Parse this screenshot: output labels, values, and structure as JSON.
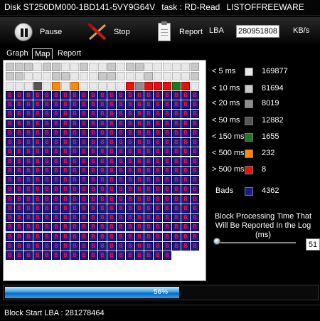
{
  "window": {
    "title_disk": "Disk ST250DM000-1BD141-5VY9G64V",
    "title_task": "task : RD-Read",
    "title_brand": "LISTOFFREEWARE"
  },
  "toolbar": {
    "pause_label": "Pause",
    "stop_label": "Stop",
    "report_label": "Report",
    "lba_label": "LBA",
    "lba_value": "280951808",
    "speed_unit": "KB/s"
  },
  "tabs": [
    {
      "label": "Graph",
      "active": false
    },
    {
      "label": "Map",
      "active": true
    },
    {
      "label": "Report",
      "active": false
    }
  ],
  "map": {
    "bad_glyph": "B",
    "cells_before_bad": [
      "g1",
      "g1",
      "g1",
      "g0",
      "g1",
      "g1",
      "g0",
      "g0",
      "g1",
      "g0",
      "g0",
      "g1",
      "g0",
      "g1",
      "g1",
      "g0",
      "g0",
      "g0",
      "g0",
      "g0",
      "g1",
      "g1",
      "g1",
      "g0",
      "g0",
      "g0",
      "g1",
      "g1",
      "g0",
      "g0",
      "g0",
      "g1",
      "g1",
      "g0",
      "g0",
      "g0",
      "g1",
      "g0",
      "g0",
      "g0",
      "g0",
      "g1",
      "g0",
      "g0",
      "g0",
      "g3",
      "g0",
      "or",
      "g0",
      "or",
      "g0",
      "g0",
      "g0",
      "g0",
      "g0",
      "rd",
      "g2",
      "rd",
      "rd",
      "rd",
      "gr",
      "rd",
      "g0"
    ],
    "bad_rows": 18,
    "columns": 21,
    "last_row_bad_count": 18
  },
  "legend": [
    {
      "label": "< 5 ms",
      "count": "169877",
      "color": "#e8e8e8"
    },
    {
      "label": "< 10 ms",
      "count": "81694",
      "color": "#c8c8c8"
    },
    {
      "label": "< 20 ms",
      "count": "8019",
      "color": "#8e8e8e"
    },
    {
      "label": "< 50 ms",
      "count": "12882",
      "color": "#555555"
    },
    {
      "label": "< 150 ms",
      "count": "1655",
      "color": "#1f7a1f"
    },
    {
      "label": "< 500 ms",
      "count": "232",
      "color": "#ff8a00"
    },
    {
      "label": "> 500 ms",
      "count": "8",
      "color": "#e81010"
    },
    {
      "label": "Bads",
      "count": "4362",
      "color": "#1a1a8c"
    }
  ],
  "block_time": {
    "label_line1": "Block Processing Time That",
    "label_line2": "Will Be Reported In the Log (ms)",
    "value": "51"
  },
  "progress": {
    "percent": 0.56,
    "text": "56%"
  },
  "status": {
    "text": "Block Start LBA : 281278464"
  }
}
